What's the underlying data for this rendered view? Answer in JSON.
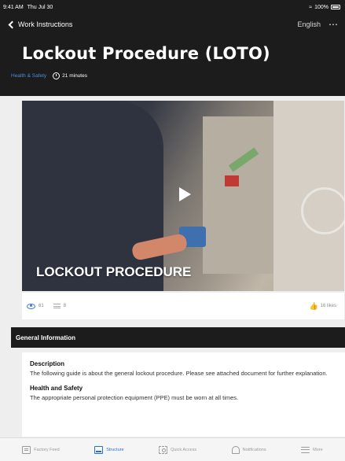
{
  "status_bar": {
    "time": "9:41 AM",
    "date": "Thu Jul 30",
    "battery": "100%"
  },
  "nav": {
    "back_label": "Work Instructions",
    "language": "English"
  },
  "page": {
    "title": "Lockout Procedure (LOTO)",
    "category": "Health & Safety",
    "duration": "21 minutes"
  },
  "video": {
    "caption": "LOCKOUT PROCEDURE"
  },
  "stats": {
    "views": "61",
    "steps": "8",
    "likes": "16 likes"
  },
  "section": {
    "title": "General Information"
  },
  "info": [
    {
      "title": "Description",
      "text": "The following guide is about the general lockout procedure. Please see attached document for further explanation."
    },
    {
      "title": "Health and Safety",
      "text": "The appropriate personal protection equipment (PPE) must be worn at all times."
    }
  ],
  "tabs": [
    {
      "label": "Factory Feed",
      "icon": "feed-icon",
      "active": false
    },
    {
      "label": "Structure",
      "icon": "structure-icon",
      "active": true
    },
    {
      "label": "Quick Access",
      "icon": "quick-access-icon",
      "active": false
    },
    {
      "label": "Notifications",
      "icon": "bell-icon",
      "active": false
    },
    {
      "label": "More",
      "icon": "menu-icon",
      "active": false
    }
  ],
  "colors": {
    "header_bg": "#1c1c1c",
    "accent": "#2f6cc7",
    "category": "#4d8ed9",
    "page_bg": "#eeeeee"
  }
}
